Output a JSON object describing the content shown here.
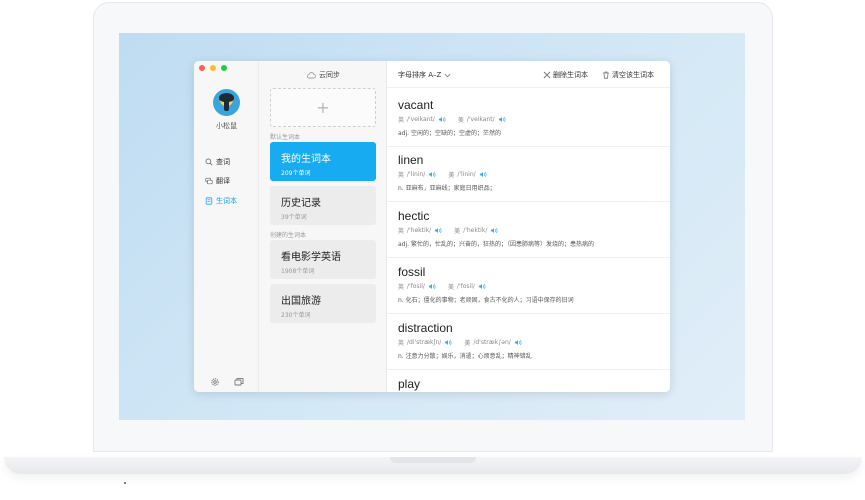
{
  "user": {
    "name": "小松鼠"
  },
  "nav": {
    "items": [
      {
        "label": "查词",
        "icon": "search-icon"
      },
      {
        "label": "翻译",
        "icon": "translate-icon"
      },
      {
        "label": "生词本",
        "icon": "notebook-icon"
      }
    ],
    "active": "生词本"
  },
  "sync": {
    "label": "云同步",
    "icon": "cloud-icon"
  },
  "add_button": {
    "label": "+"
  },
  "groups": {
    "default_label": "默认生词本",
    "created_label": "创建的生词本"
  },
  "books": [
    {
      "name": "我的生词本",
      "count": "209个单词",
      "active": true
    },
    {
      "name": "历史记录",
      "count": "39个单词",
      "active": false
    },
    {
      "name": "看电影学英语",
      "count": "1908个单词",
      "active": false
    },
    {
      "name": "出国旅游",
      "count": "230个单词",
      "active": false
    }
  ],
  "toolbar": {
    "sort_label": "字母排序 A–Z",
    "delete_label": "删除生词本",
    "clear_label": "清空该生词本"
  },
  "words": [
    {
      "word": "vacant",
      "uk_label": "英",
      "uk": "/'veikant/",
      "us_label": "美",
      "us": "/'veikant/",
      "def": "adj. 空闲的；空缺的；空虚的；茫然的"
    },
    {
      "word": "linen",
      "uk_label": "英",
      "uk": "/'linin/",
      "us_label": "美",
      "us": "/'linin/",
      "def": "n. 亚麻布，亚麻线；家庭日用织品；"
    },
    {
      "word": "hectic",
      "uk_label": "英",
      "uk": "/'hektik/",
      "us_label": "美",
      "us": "/'hektik/",
      "def": "adj. 繁忙的，忙乱的；兴奋的，狂热的；（因患肺病等）发烧的；患热病的"
    },
    {
      "word": "fossil",
      "uk_label": "英",
      "uk": "/'fosil/",
      "us_label": "美",
      "us": "/'fosil/",
      "def": "n. 化石；僵化的事物；老顽固，食古不化的人；习语中保存的旧词"
    },
    {
      "word": "distraction",
      "uk_label": "英",
      "uk": "/di'strækʃn/",
      "us_label": "美",
      "us": "/d'stræk∫ən/",
      "def": "n. 注意力分散；娱乐，消遣；心烦意乱；精神错乱"
    },
    {
      "word": "play",
      "uk_label": "",
      "uk": "",
      "us_label": "",
      "us": "",
      "def": ""
    }
  ],
  "colors": {
    "accent": "#17abf1",
    "sidebar_bg": "#f7f7f7",
    "card_bg": "#ececec"
  }
}
